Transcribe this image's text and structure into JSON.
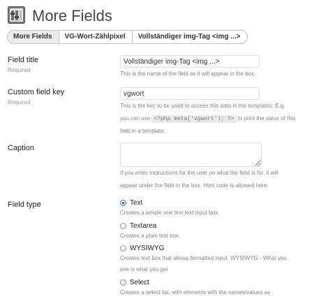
{
  "header": {
    "title": "More Fields",
    "icon": "settings-page-icon"
  },
  "breadcrumb": {
    "items": [
      "More Fields",
      "VG-Wort-Zählpixel",
      "Vollständiger img-Tag <img ...>"
    ]
  },
  "fields": {
    "title": {
      "label": "Field title",
      "required": "Required",
      "value": "Vollständiger img-Tag <img ...>",
      "description": "This is the name of the field as it will appear in the box."
    },
    "key": {
      "label": "Custom field key",
      "required": "Required",
      "value": "vgwort",
      "description_line1": "This is the key to be used to access this data in the templates. E.g.",
      "description_line2_pre": "you can use",
      "description_code": "<?php meta('vgwort'); ?>",
      "description_line2_post": "to print the value of this",
      "description_line3": "field in a template."
    },
    "caption": {
      "label": "Caption",
      "value": "",
      "description_line1": "If you enter instructions for the user on what the field is for, it will",
      "description_line2": "appear under the field in the box. Html code is allowed here."
    },
    "type": {
      "label": "Field type",
      "selected": "Text",
      "options": [
        {
          "label": "Text",
          "description": "Creates a simple one line text input box."
        },
        {
          "label": "Textarea",
          "description": "Creates a plain text box."
        },
        {
          "label": "WYSIWYG",
          "description_line1": "Creates text box that allows formatted input. WYSIWYG - What you",
          "description_line2": "see is what you get"
        },
        {
          "label": "Select",
          "description": "Creates a select list, with elements with the names/values as"
        }
      ]
    }
  }
}
